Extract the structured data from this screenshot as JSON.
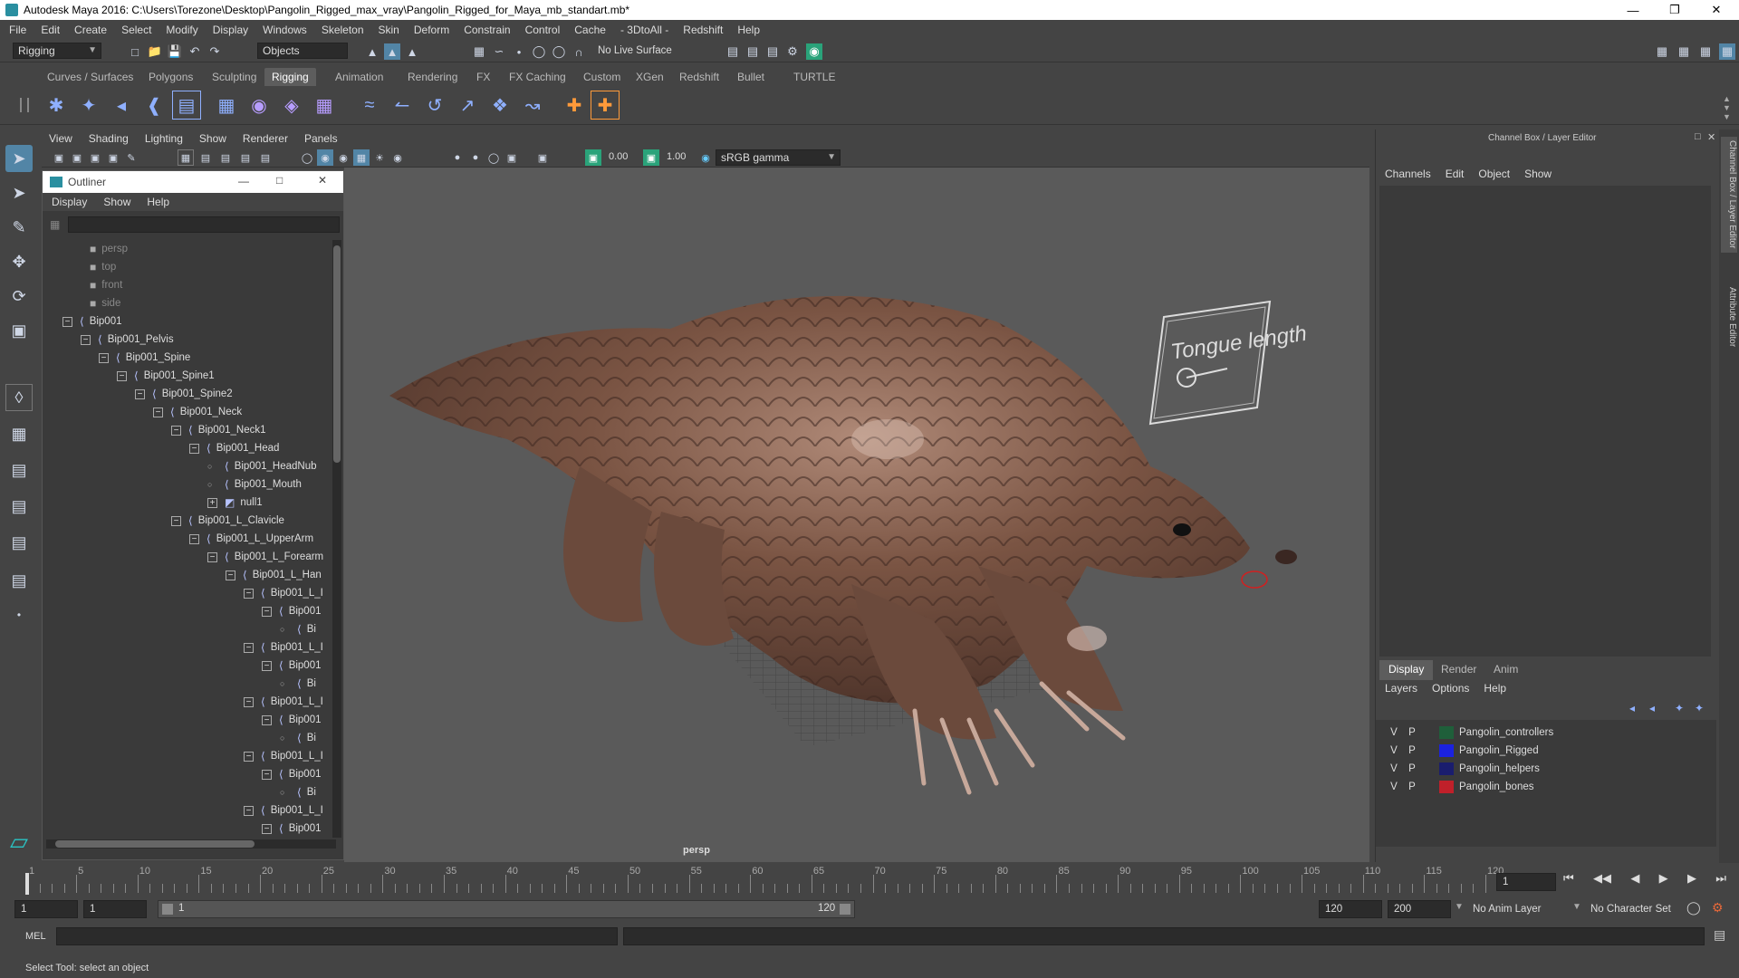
{
  "window": {
    "title": "Autodesk Maya 2016: C:\\Users\\Torezone\\Desktop\\Pangolin_Rigged_max_vray\\Pangolin_Rigged_for_Maya_mb_standart.mb*"
  },
  "menubar": [
    "File",
    "Edit",
    "Create",
    "Select",
    "Modify",
    "Display",
    "Windows",
    "Skeleton",
    "Skin",
    "Deform",
    "Constrain",
    "Control",
    "Cache",
    "- 3DtoAll -",
    "Redshift",
    "Help"
  ],
  "statusline": {
    "mode": "Rigging",
    "select_mode": "Objects",
    "live_surface": "No Live Surface"
  },
  "shelf_tabs": [
    "Curves / Surfaces",
    "Polygons",
    "Sculpting",
    "Rigging",
    "Animation",
    "Rendering",
    "FX",
    "FX Caching",
    "Custom",
    "XGen",
    "Redshift",
    "Bullet",
    "TURTLE"
  ],
  "shelf_active": "Rigging",
  "viewport": {
    "menus": [
      "View",
      "Shading",
      "Lighting",
      "Show",
      "Renderer",
      "Panels"
    ],
    "exposure": "0.00",
    "gamma": "1.00",
    "color_space": "sRGB gamma",
    "camera_label": "persp",
    "controller_text": "Tongue length"
  },
  "outliner": {
    "title": "Outliner",
    "menus": [
      "Display",
      "Show",
      "Help"
    ],
    "items": [
      {
        "label": "persp",
        "depth": 0,
        "type": "cam"
      },
      {
        "label": "top",
        "depth": 0,
        "type": "cam"
      },
      {
        "label": "front",
        "depth": 0,
        "type": "cam"
      },
      {
        "label": "side",
        "depth": 0,
        "type": "cam"
      },
      {
        "label": "Bip001",
        "depth": 0,
        "type": "bone"
      },
      {
        "label": "Bip001_Pelvis",
        "depth": 1,
        "type": "bone"
      },
      {
        "label": "Bip001_Spine",
        "depth": 2,
        "type": "bone"
      },
      {
        "label": "Bip001_Spine1",
        "depth": 3,
        "type": "bone"
      },
      {
        "label": "Bip001_Spine2",
        "depth": 4,
        "type": "bone"
      },
      {
        "label": "Bip001_Neck",
        "depth": 5,
        "type": "bone"
      },
      {
        "label": "Bip001_Neck1",
        "depth": 6,
        "type": "bone"
      },
      {
        "label": "Bip001_Head",
        "depth": 7,
        "type": "bone"
      },
      {
        "label": "Bip001_HeadNub",
        "depth": 8,
        "type": "leaf"
      },
      {
        "label": "Bip001_Mouth",
        "depth": 8,
        "type": "leaf"
      },
      {
        "label": "null1",
        "depth": 8,
        "type": "null"
      },
      {
        "label": "Bip001_L_Clavicle",
        "depth": 6,
        "type": "bone"
      },
      {
        "label": "Bip001_L_UpperArm",
        "depth": 7,
        "type": "bone"
      },
      {
        "label": "Bip001_L_Forearm",
        "depth": 8,
        "type": "bone"
      },
      {
        "label": "Bip001_L_Han",
        "depth": 9,
        "type": "bone"
      },
      {
        "label": "Bip001_L_I",
        "depth": 10,
        "type": "bone"
      },
      {
        "label": "Bip001",
        "depth": 11,
        "type": "bone"
      },
      {
        "label": "Bi",
        "depth": 12,
        "type": "leaf"
      },
      {
        "label": "Bip001_L_I",
        "depth": 10,
        "type": "bone"
      },
      {
        "label": "Bip001",
        "depth": 11,
        "type": "bone"
      },
      {
        "label": "Bi",
        "depth": 12,
        "type": "leaf"
      },
      {
        "label": "Bip001_L_I",
        "depth": 10,
        "type": "bone"
      },
      {
        "label": "Bip001",
        "depth": 11,
        "type": "bone"
      },
      {
        "label": "Bi",
        "depth": 12,
        "type": "leaf"
      },
      {
        "label": "Bip001_L_I",
        "depth": 10,
        "type": "bone"
      },
      {
        "label": "Bip001",
        "depth": 11,
        "type": "bone"
      },
      {
        "label": "Bi",
        "depth": 12,
        "type": "leaf"
      },
      {
        "label": "Bip001_L_I",
        "depth": 10,
        "type": "bone"
      },
      {
        "label": "Bip001",
        "depth": 11,
        "type": "bone"
      }
    ]
  },
  "channel_box": {
    "title": "Channel Box / Layer Editor",
    "menus": [
      "Channels",
      "Edit",
      "Object",
      "Show"
    ]
  },
  "layer_editor": {
    "tabs": [
      "Display",
      "Render",
      "Anim"
    ],
    "active_tab": "Display",
    "menus": [
      "Layers",
      "Options",
      "Help"
    ],
    "layers": [
      {
        "v": "V",
        "p": "P",
        "name": "Pangolin_controllers",
        "color": "#1f5f3a"
      },
      {
        "v": "V",
        "p": "P",
        "name": "Pangolin_Rigged",
        "color": "#1b22e0"
      },
      {
        "v": "V",
        "p": "P",
        "name": "Pangolin_helpers",
        "color": "#1a1d6e"
      },
      {
        "v": "V",
        "p": "P",
        "name": "Pangolin_bones",
        "color": "#c0202a"
      }
    ]
  },
  "side_tabs": [
    "Channel Box / Layer Editor",
    "Attribute Editor"
  ],
  "timeslider": {
    "labels": [
      "1",
      "5",
      "10",
      "15",
      "20",
      "25",
      "30",
      "35",
      "40",
      "45",
      "50",
      "55",
      "60",
      "65",
      "70",
      "75",
      "80",
      "85",
      "90",
      "95",
      "100",
      "105",
      "110",
      "115",
      "120"
    ],
    "current_frame": "1"
  },
  "range": {
    "start": "1",
    "playback_start": "1",
    "slider_start": "1",
    "slider_end": "120",
    "playback_end": "120",
    "end": "200",
    "anim_layer": "No Anim Layer",
    "character_set": "No Character Set"
  },
  "cmdline": {
    "label": "MEL"
  },
  "helpline": {
    "text": "Select Tool: select an object"
  }
}
